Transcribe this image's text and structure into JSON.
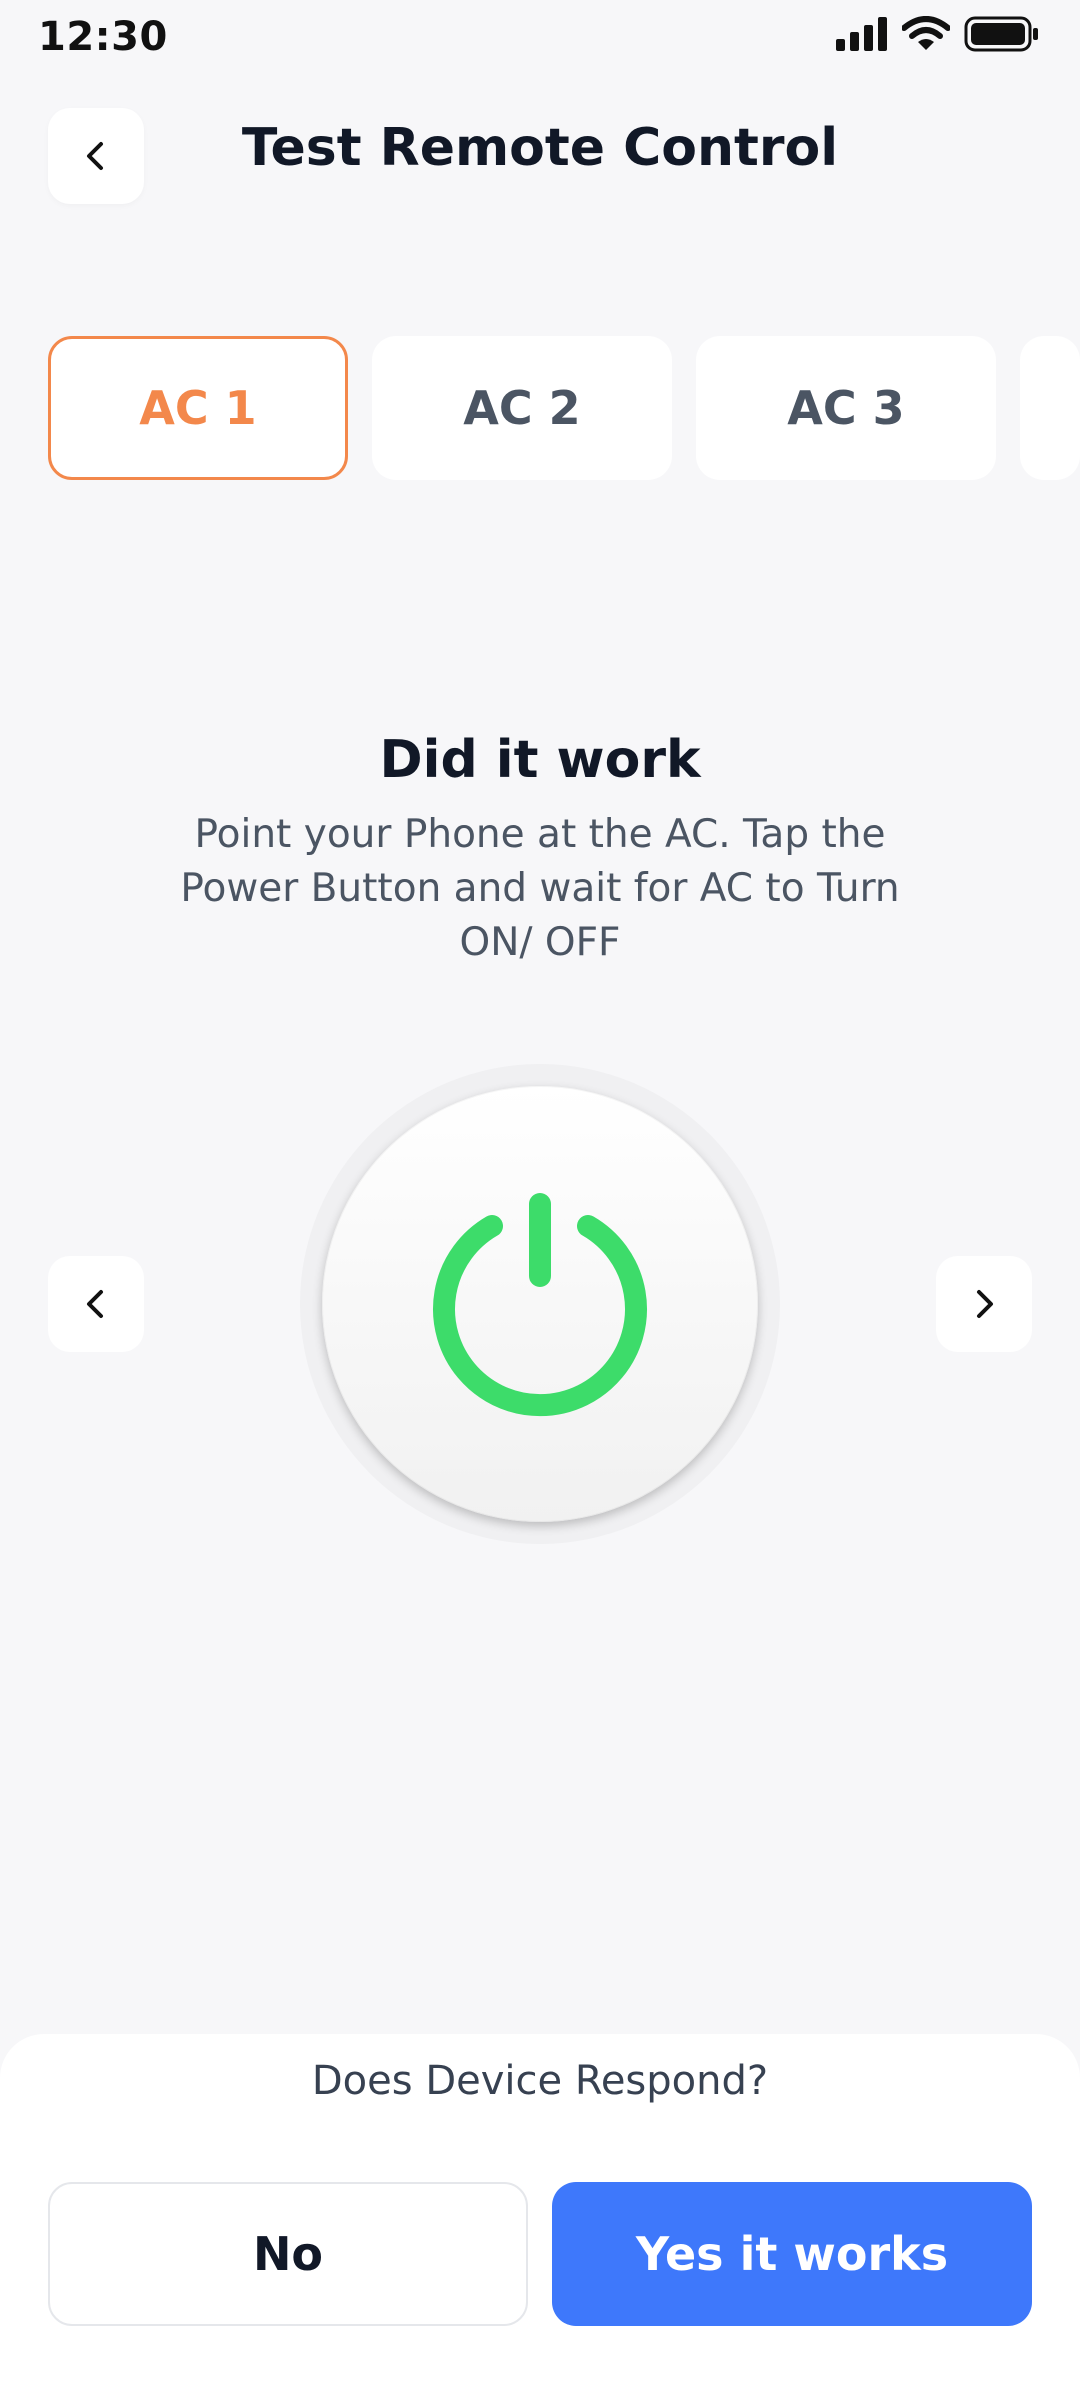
{
  "status_bar": {
    "time": "12:30"
  },
  "header": {
    "title": "Test Remote Control"
  },
  "tabs": [
    {
      "label": "AC 1",
      "active": true
    },
    {
      "label": "AC 2",
      "active": false
    },
    {
      "label": "AC 3",
      "active": false
    }
  ],
  "instructions": {
    "title": "Did it work",
    "body": "Point your Phone at the AC. Tap the Power Button and wait for AC to Turn ON/ OFF"
  },
  "power": {
    "icon": "power-icon",
    "color": "#3ddc6a"
  },
  "bottom": {
    "question": "Does Device Respond?",
    "no_label": "No",
    "yes_label": "Yes it works"
  },
  "colors": {
    "accent": "#f3884b",
    "primary": "#3e78fb",
    "background": "#f7f7f9"
  }
}
